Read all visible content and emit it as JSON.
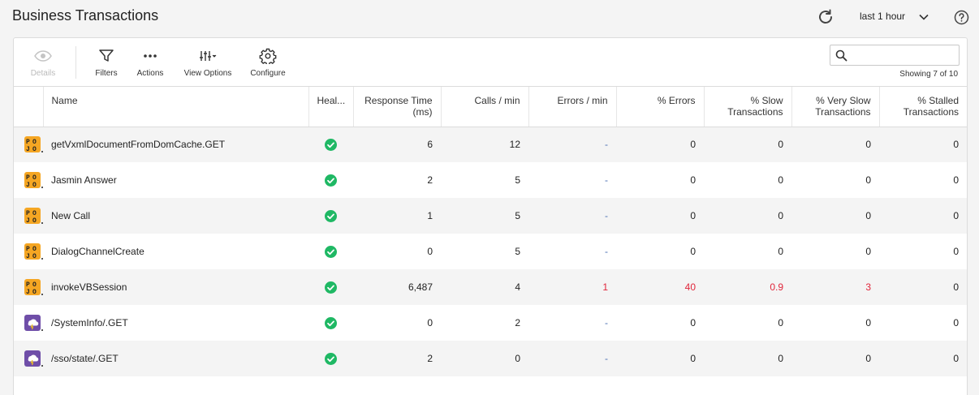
{
  "header": {
    "title": "Business Transactions",
    "time_range": "last 1 hour"
  },
  "toolbar": {
    "details_label": "Details",
    "filters_label": "Filters",
    "actions_label": "Actions",
    "view_options_label": "View Options",
    "configure_label": "Configure"
  },
  "search": {
    "value": "",
    "placeholder": "",
    "showing": "Showing 7 of 10"
  },
  "table": {
    "columns": {
      "name": "Name",
      "health": "Heal...",
      "response": "Response Time (ms)",
      "calls": "Calls / min",
      "errors_min": "Errors / min",
      "pct_errors": "% Errors",
      "pct_slow": "% Slow Transactions",
      "pct_very_slow": "% Very Slow Transactions",
      "pct_stalled": "% Stalled Transactions"
    },
    "rows": [
      {
        "icon": "pojo-icon",
        "name": "getVxmlDocumentFromDomCache.GET",
        "response": "6",
        "calls": "12",
        "errors_min": "-",
        "pct_errors": "0",
        "pct_slow": "0",
        "pct_very_slow": "0",
        "pct_stalled": "0"
      },
      {
        "icon": "pojo-icon",
        "name": "Jasmin Answer",
        "response": "2",
        "calls": "5",
        "errors_min": "-",
        "pct_errors": "0",
        "pct_slow": "0",
        "pct_very_slow": "0",
        "pct_stalled": "0"
      },
      {
        "icon": "pojo-icon",
        "name": "New Call",
        "response": "1",
        "calls": "5",
        "errors_min": "-",
        "pct_errors": "0",
        "pct_slow": "0",
        "pct_very_slow": "0",
        "pct_stalled": "0"
      },
      {
        "icon": "pojo-icon",
        "name": "DialogChannelCreate",
        "response": "0",
        "calls": "5",
        "errors_min": "-",
        "pct_errors": "0",
        "pct_slow": "0",
        "pct_very_slow": "0",
        "pct_stalled": "0"
      },
      {
        "icon": "pojo-icon",
        "name": "invokeVBSession",
        "response": "6,487",
        "calls": "4",
        "errors_min": "1",
        "pct_errors": "40",
        "pct_slow": "0.9",
        "pct_very_slow": "3",
        "pct_stalled": "0"
      },
      {
        "icon": "servlet-icon",
        "name": "/SystemInfo/.GET",
        "response": "0",
        "calls": "2",
        "errors_min": "-",
        "pct_errors": "0",
        "pct_slow": "0",
        "pct_very_slow": "0",
        "pct_stalled": "0"
      },
      {
        "icon": "servlet-icon",
        "name": "/sso/state/.GET",
        "response": "2",
        "calls": "0",
        "errors_min": "-",
        "pct_errors": "0",
        "pct_slow": "0",
        "pct_very_slow": "0",
        "pct_stalled": "0"
      }
    ]
  },
  "colors": {
    "health_ok": "#1fb864",
    "error_red": "#e0253a",
    "dash_blue": "#4a6fb3",
    "pojo_bg": "#f5a623",
    "servlet_bg": "#6f4ea8"
  }
}
